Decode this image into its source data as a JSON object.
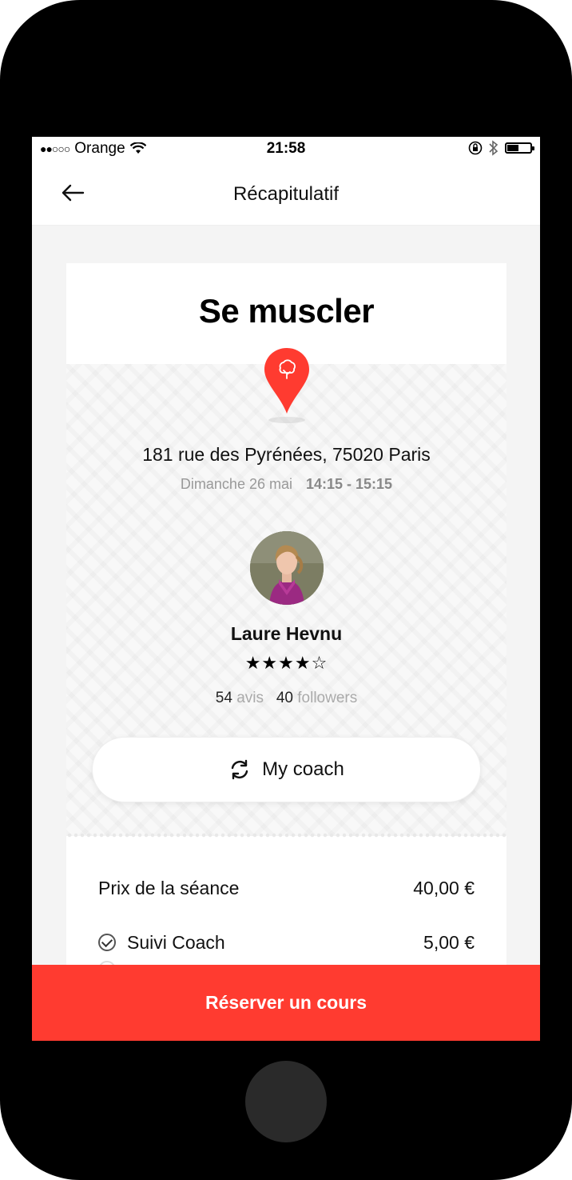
{
  "status_bar": {
    "signal_dots": "●●○○○",
    "carrier": "Orange",
    "time": "21:58",
    "battery_level": 0.5
  },
  "header": {
    "back_icon": "arrow-left-icon",
    "title": "Récapitulatif"
  },
  "session": {
    "title": "Se muscler",
    "pin_icon": "tree-location-pin-icon",
    "address": "181 rue des Pyrénées, 75020 Paris",
    "date": "Dimanche 26 mai",
    "hours": "14:15 - 15:15"
  },
  "coach": {
    "name": "Laure Hevnu",
    "stars": "★★★★☆",
    "rating": 4,
    "reviews_count": "54",
    "reviews_label": "avis",
    "followers_count": "40",
    "followers_label": "followers",
    "button_label": "My coach",
    "button_icon": "refresh-icon"
  },
  "pricing": {
    "session_label": "Prix de la séance",
    "session_price": "40,00 €",
    "options": [
      {
        "label": "Suivi Coach",
        "price": "5,00 €",
        "checked": true
      }
    ]
  },
  "cta": {
    "label": "Réserver un cours"
  },
  "colors": {
    "accent": "#ff3b30",
    "background": "#f4f4f4"
  }
}
